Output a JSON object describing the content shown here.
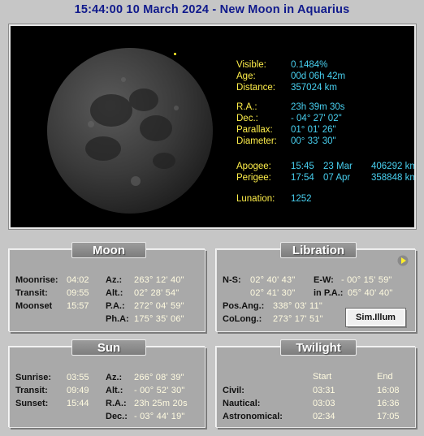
{
  "header": {
    "title": "15:44:00  10 March 2024 - New Moon in Aquarius"
  },
  "moon_info": {
    "rows": [
      {
        "label": "Visible:",
        "value": "0.1484%"
      },
      {
        "label": "Age:",
        "value": "00d 06h 42m"
      },
      {
        "label": "Distance:",
        "value": "357024 km"
      },
      {
        "label": "R.A.:",
        "value": "23h 39m 30s"
      },
      {
        "label": "Dec.:",
        "value": "- 04° 27' 02\""
      },
      {
        "label": "Parallax:",
        "value": "01° 01' 26\""
      },
      {
        "label": "Diameter:",
        "value": "00° 33' 30\""
      }
    ],
    "apogee": {
      "label": "Apogee:",
      "time": "15:45",
      "date": "23 Mar",
      "dist": "406292 km"
    },
    "perigee": {
      "label": "Perigee:",
      "time": "17:54",
      "date": "07 Apr",
      "dist": "358848 km"
    },
    "lunation": {
      "label": "Lunation:",
      "value": "1252"
    }
  },
  "moon_panel": {
    "title": "Moon",
    "left": [
      {
        "label": "Moonrise:",
        "value": "04:02"
      },
      {
        "label": "Transit:",
        "value": "09:55"
      },
      {
        "label": "Moonset",
        "value": "15:57"
      }
    ],
    "right": [
      {
        "label": "Az.:",
        "value": "263° 12' 40\""
      },
      {
        "label": "Alt.:",
        "value": "02° 28' 54\""
      },
      {
        "label": "P.A.:",
        "value": "272° 04' 59\""
      },
      {
        "label": "Ph.A:",
        "value": "175° 35' 06\""
      }
    ]
  },
  "libration_panel": {
    "title": "Libration",
    "ns_label": "N-S:",
    "ns_value": "02° 40' 43\"",
    "ew_label": "E-W:",
    "ew_value": "- 00° 15' 59\"",
    "ns2_value": "02° 41' 30\"",
    "pa_label": "in P.A.:",
    "pa_value": "05° 40' 40\"",
    "posang_label": "Pos.Ang.:",
    "posang_value": "338° 03' 11\"",
    "colong_label": "CoLong.:",
    "colong_value": "273° 17' 51\"",
    "sim_button": "Sim.Illum"
  },
  "sun_panel": {
    "title": "Sun",
    "left": [
      {
        "label": "Sunrise:",
        "value": "03:55"
      },
      {
        "label": "Transit:",
        "value": "09:49"
      },
      {
        "label": "Sunset:",
        "value": "15:44"
      }
    ],
    "right": [
      {
        "label": "Az.:",
        "value": "266° 08' 39\""
      },
      {
        "label": "Alt.:",
        "value": "- 00° 52' 30\""
      },
      {
        "label": "R.A.:",
        "value": "23h 25m 20s"
      },
      {
        "label": "Dec.:",
        "value": "- 03° 44' 19\""
      }
    ]
  },
  "twilight_panel": {
    "title": "Twilight",
    "col_start": "Start",
    "col_end": "End",
    "rows": [
      {
        "label": "Civil:",
        "start": "03:31",
        "end": "16:08"
      },
      {
        "label": "Nautical:",
        "start": "03:03",
        "end": "16:36"
      },
      {
        "label": "Astronomical:",
        "start": "02:34",
        "end": "17:05"
      }
    ]
  },
  "colors": {
    "title": "#101a8c",
    "info_label": "#ffef4a",
    "info_value": "#48d0f0",
    "panel_value": "#fffbe0"
  }
}
